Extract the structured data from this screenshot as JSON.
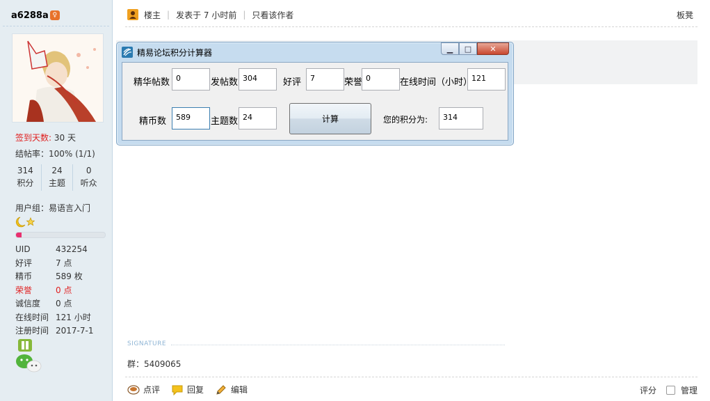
{
  "sidebar": {
    "username": "a6288a",
    "checkin_label": "签到天数:",
    "checkin_value": "30 天",
    "rate": "结帖率：100% (1/1)",
    "stats": [
      {
        "num": "314",
        "label": "积分"
      },
      {
        "num": "24",
        "label": "主题"
      },
      {
        "num": "0",
        "label": "听众"
      }
    ],
    "group": "用户组：易语言入门",
    "progress_fraction": 0.06,
    "info": [
      {
        "k": "UID",
        "v": "432254"
      },
      {
        "k": "好评",
        "v": "7 点"
      },
      {
        "k": "精币",
        "v": "589 枚"
      },
      {
        "k": "荣誉",
        "v": "0 点"
      },
      {
        "k": "诚信度",
        "v": "0 点"
      },
      {
        "k": "在线时间",
        "v": "121 小时"
      },
      {
        "k": "注册时间",
        "v": "2017-7-1"
      }
    ]
  },
  "post_header": {
    "owner": "楼主",
    "posted": "发表于 7 小时前",
    "only_author": "只看该作者",
    "board": "板凳"
  },
  "dialog": {
    "title": "精易论坛积分计算器",
    "labels": {
      "essence": "精华帖数",
      "posts": "发帖数",
      "good": "好评",
      "honor": "荣誉",
      "online": "在线时间（小时）",
      "coins": "精币数",
      "topics": "主题数",
      "result": "您的积分为:"
    },
    "values": {
      "essence": "0",
      "posts": "304",
      "good": "7",
      "honor": "0",
      "online": "121",
      "coins": "589",
      "topics": "24",
      "result": "314"
    },
    "calc_button": "计算"
  },
  "signature": {
    "label": "SIGNATURE",
    "text": "群：5409065"
  },
  "footer": {
    "comment": "点评",
    "reply": "回复",
    "edit": "编辑",
    "rate": "评分",
    "manage": "管理"
  },
  "colors": {
    "sidebar_bg": "#e5edf2",
    "accent_red": "#e02020",
    "progress_fill": "#e8306f"
  }
}
